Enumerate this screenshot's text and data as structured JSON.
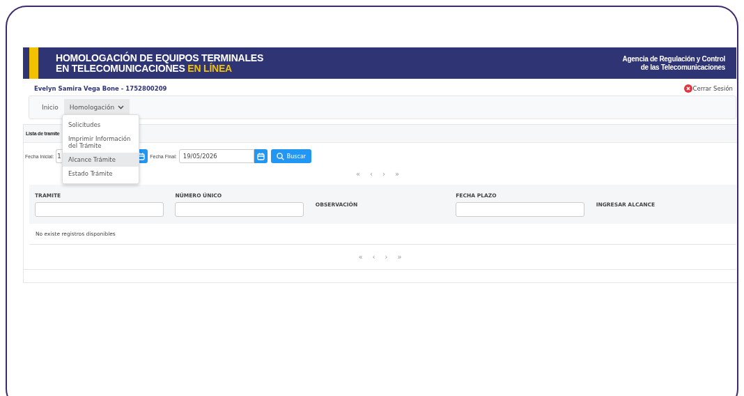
{
  "header": {
    "title_line_1": "HOMOLOGACIÓN DE EQUIPOS TERMINALES",
    "title_line_2": "EN TELECOMUNICACIONES",
    "title_highlight": "EN LÍNEA",
    "agency_line_1": "Agencia de Regulación y Control",
    "agency_line_2": "de las Telecomunicaciones"
  },
  "user": {
    "name": "Evelyn Samira Vega Bone - 1752800209",
    "logout": "Cerrar Sesión"
  },
  "nav": {
    "items": [
      {
        "label": "Inicio",
        "kind": "link",
        "selected": false
      },
      {
        "label": "Homologación",
        "kind": "dropdown",
        "selected": true
      }
    ],
    "menu": [
      {
        "label": "Solicitudes",
        "selected": false
      },
      {
        "label": "Imprimir Información del Trámite",
        "selected": false
      },
      {
        "label": "Alcance Trámite",
        "selected": true
      },
      {
        "label": "Estado Trámite",
        "selected": false
      }
    ]
  },
  "section": {
    "title": "Lista de tramite",
    "start_label": "Fecha Inicial:",
    "start_value": "1",
    "end_label": "Fecha Final:",
    "end_value": "19/05/2026",
    "search_button": "Buscar"
  },
  "pagination": [
    "«",
    "‹",
    "›",
    "»"
  ],
  "table": {
    "columns": [
      {
        "label": "TRAMITE",
        "filter": true
      },
      {
        "label": "NÚMERO ÚNICO",
        "filter": true
      },
      {
        "label": "OBSERVACIÓN",
        "filter": false
      },
      {
        "label": "FECHA PLAZO",
        "filter": true
      },
      {
        "label": "INGRESAR ALCANCE",
        "filter": false
      }
    ],
    "empty_message": "No existe registros disponibles"
  }
}
